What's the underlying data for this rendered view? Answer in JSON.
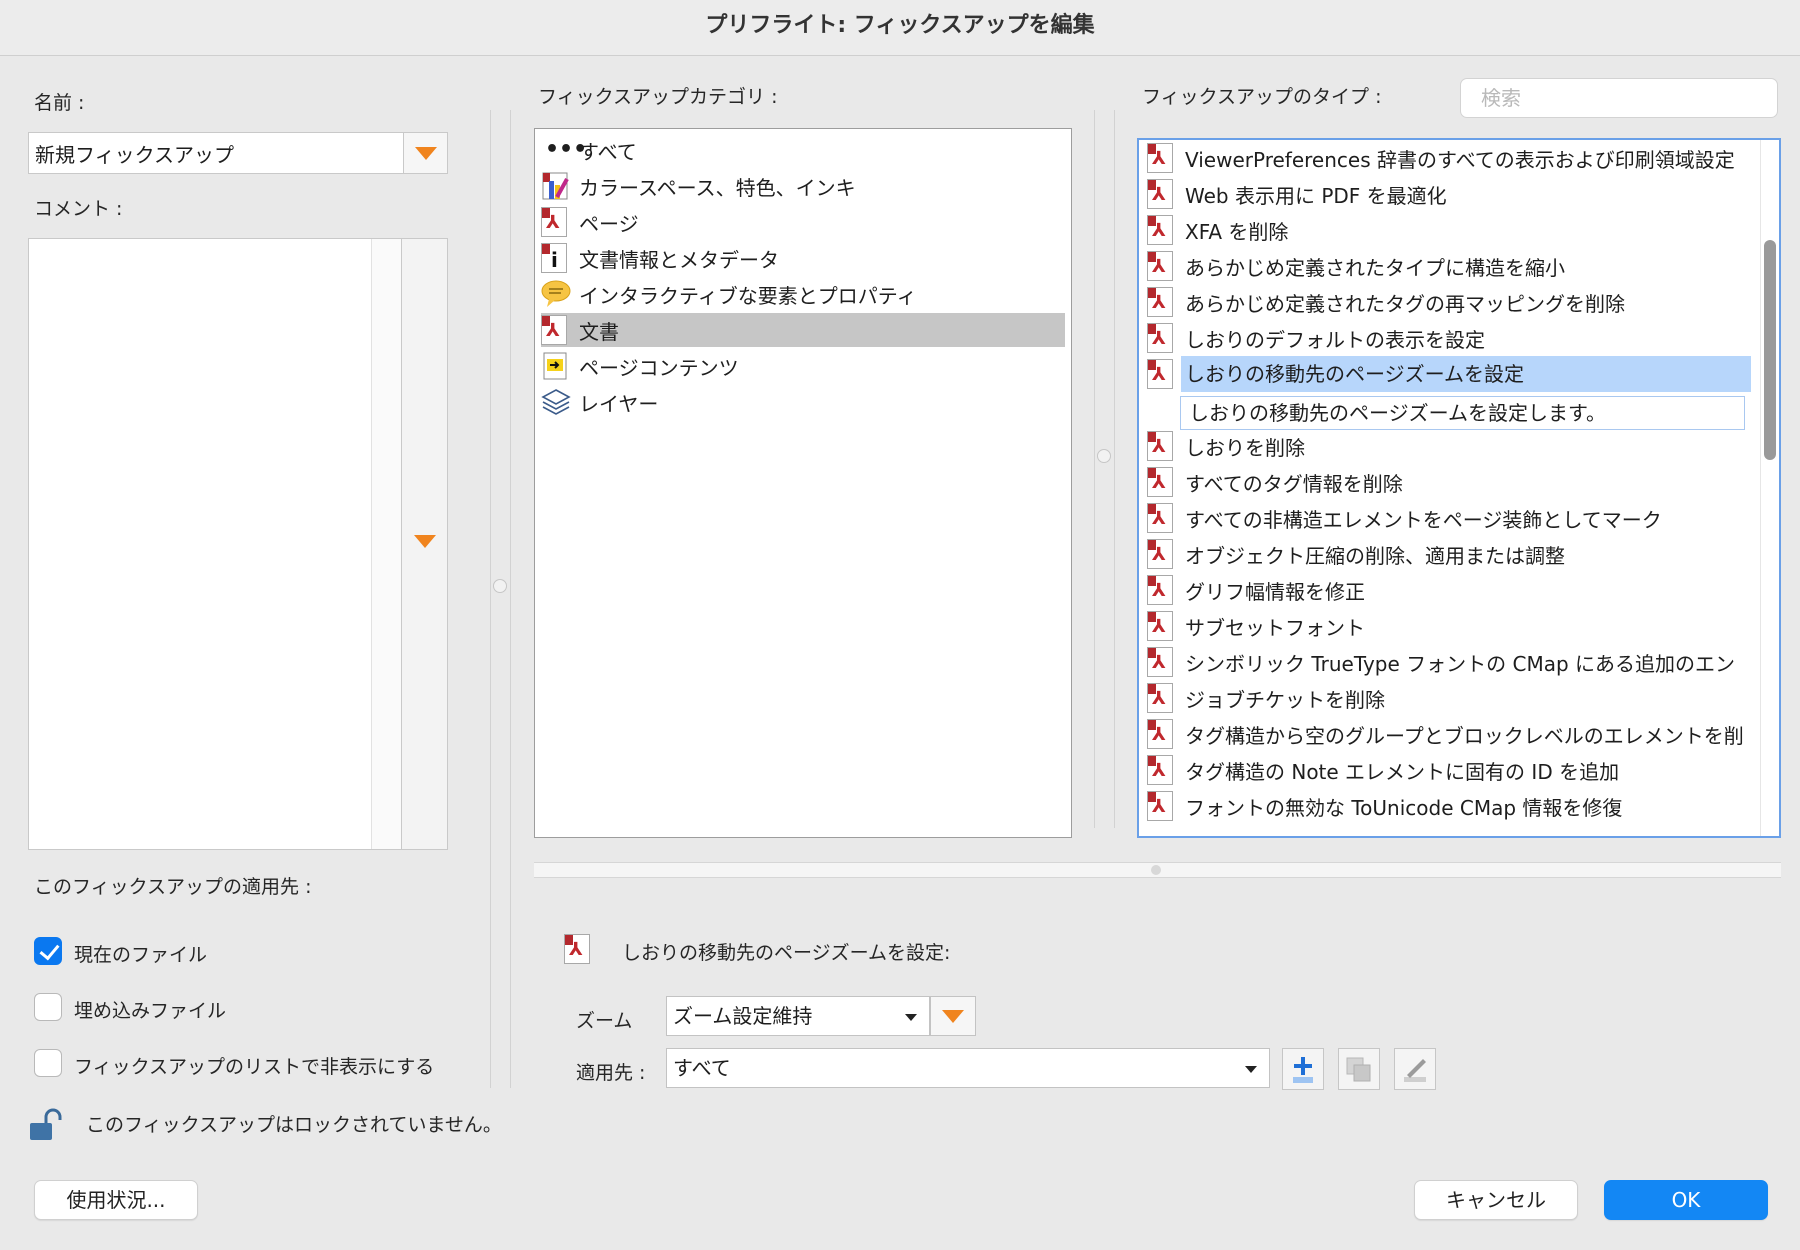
{
  "window": {
    "title": "プリフライト: フィックスアップを編集"
  },
  "name": {
    "label": "名前 :",
    "value": "新規フィックスアップ"
  },
  "comment": {
    "label": "コメント :",
    "value": ""
  },
  "applies": {
    "label": "このフィックスアップの適用先 :",
    "options": [
      {
        "label": "現在のファイル",
        "checked": true
      },
      {
        "label": "埋め込みファイル",
        "checked": false
      },
      {
        "label": "フィックスアップのリストで非表示にする",
        "checked": false
      }
    ]
  },
  "lock": {
    "text": "このフィックスアップはロックされていません。",
    "icon": "unlocked-padlock-icon"
  },
  "category": {
    "label": "フィックスアップカテゴリ :",
    "items": [
      {
        "label": "すべて",
        "icon": "ellipsis-icon"
      },
      {
        "label": "カラースペース、特色、インキ",
        "icon": "color-space-icon"
      },
      {
        "label": "ページ",
        "icon": "pdf-page-icon"
      },
      {
        "label": "文書情報とメタデータ",
        "icon": "document-info-icon"
      },
      {
        "label": "インタラクティブな要素とプロパティ",
        "icon": "comment-bubble-icon"
      },
      {
        "label": "文書",
        "icon": "pdf-document-icon",
        "selected": true
      },
      {
        "label": "ページコンテンツ",
        "icon": "page-content-icon"
      },
      {
        "label": "レイヤー",
        "icon": "layers-icon"
      }
    ]
  },
  "types": {
    "label": "フィックスアップのタイプ :",
    "search_placeholder": "検索",
    "items": [
      {
        "label": "ViewerPreferences 辞書のすべての表示および印刷領域設定"
      },
      {
        "label": "Web 表示用に PDF を最適化"
      },
      {
        "label": "XFA を削除"
      },
      {
        "label": "あらかじめ定義されたタイプに構造を縮小"
      },
      {
        "label": "あらかじめ定義されたタグの再マッピングを削除"
      },
      {
        "label": "しおりのデフォルトの表示を設定"
      },
      {
        "label": "しおりの移動先のページズームを設定",
        "selected": true
      },
      {
        "label": "しおりを削除"
      },
      {
        "label": "すべてのタグ情報を削除"
      },
      {
        "label": "すべての非構造エレメントをページ装飾としてマーク"
      },
      {
        "label": "オブジェクト圧縮の削除、適用または調整"
      },
      {
        "label": "グリフ幅情報を修正"
      },
      {
        "label": "サブセットフォント"
      },
      {
        "label": "シンボリック TrueType フォントの CMap にある追加のエン"
      },
      {
        "label": "ジョブチケットを削除"
      },
      {
        "label": "タグ構造から空のグループとブロックレベルのエレメントを削"
      },
      {
        "label": "タグ構造の Note エレメントに固有の ID を追加"
      },
      {
        "label": "フォントの無効な ToUnicode CMap 情報を修復"
      }
    ],
    "selected_description": "しおりの移動先のページズームを設定します。"
  },
  "detail": {
    "heading": "しおりの移動先のページズームを設定:",
    "zoom_label": "ズーム",
    "zoom_value": "ズーム設定維持",
    "apply_label": "適用先 :",
    "apply_value": "すべて"
  },
  "buttons": {
    "usage": "使用状況...",
    "cancel": "キャンセル",
    "ok": "OK"
  },
  "colors": {
    "accent": "#1387f4",
    "selection": "#b7d6fb",
    "orange": "#f0841e"
  }
}
